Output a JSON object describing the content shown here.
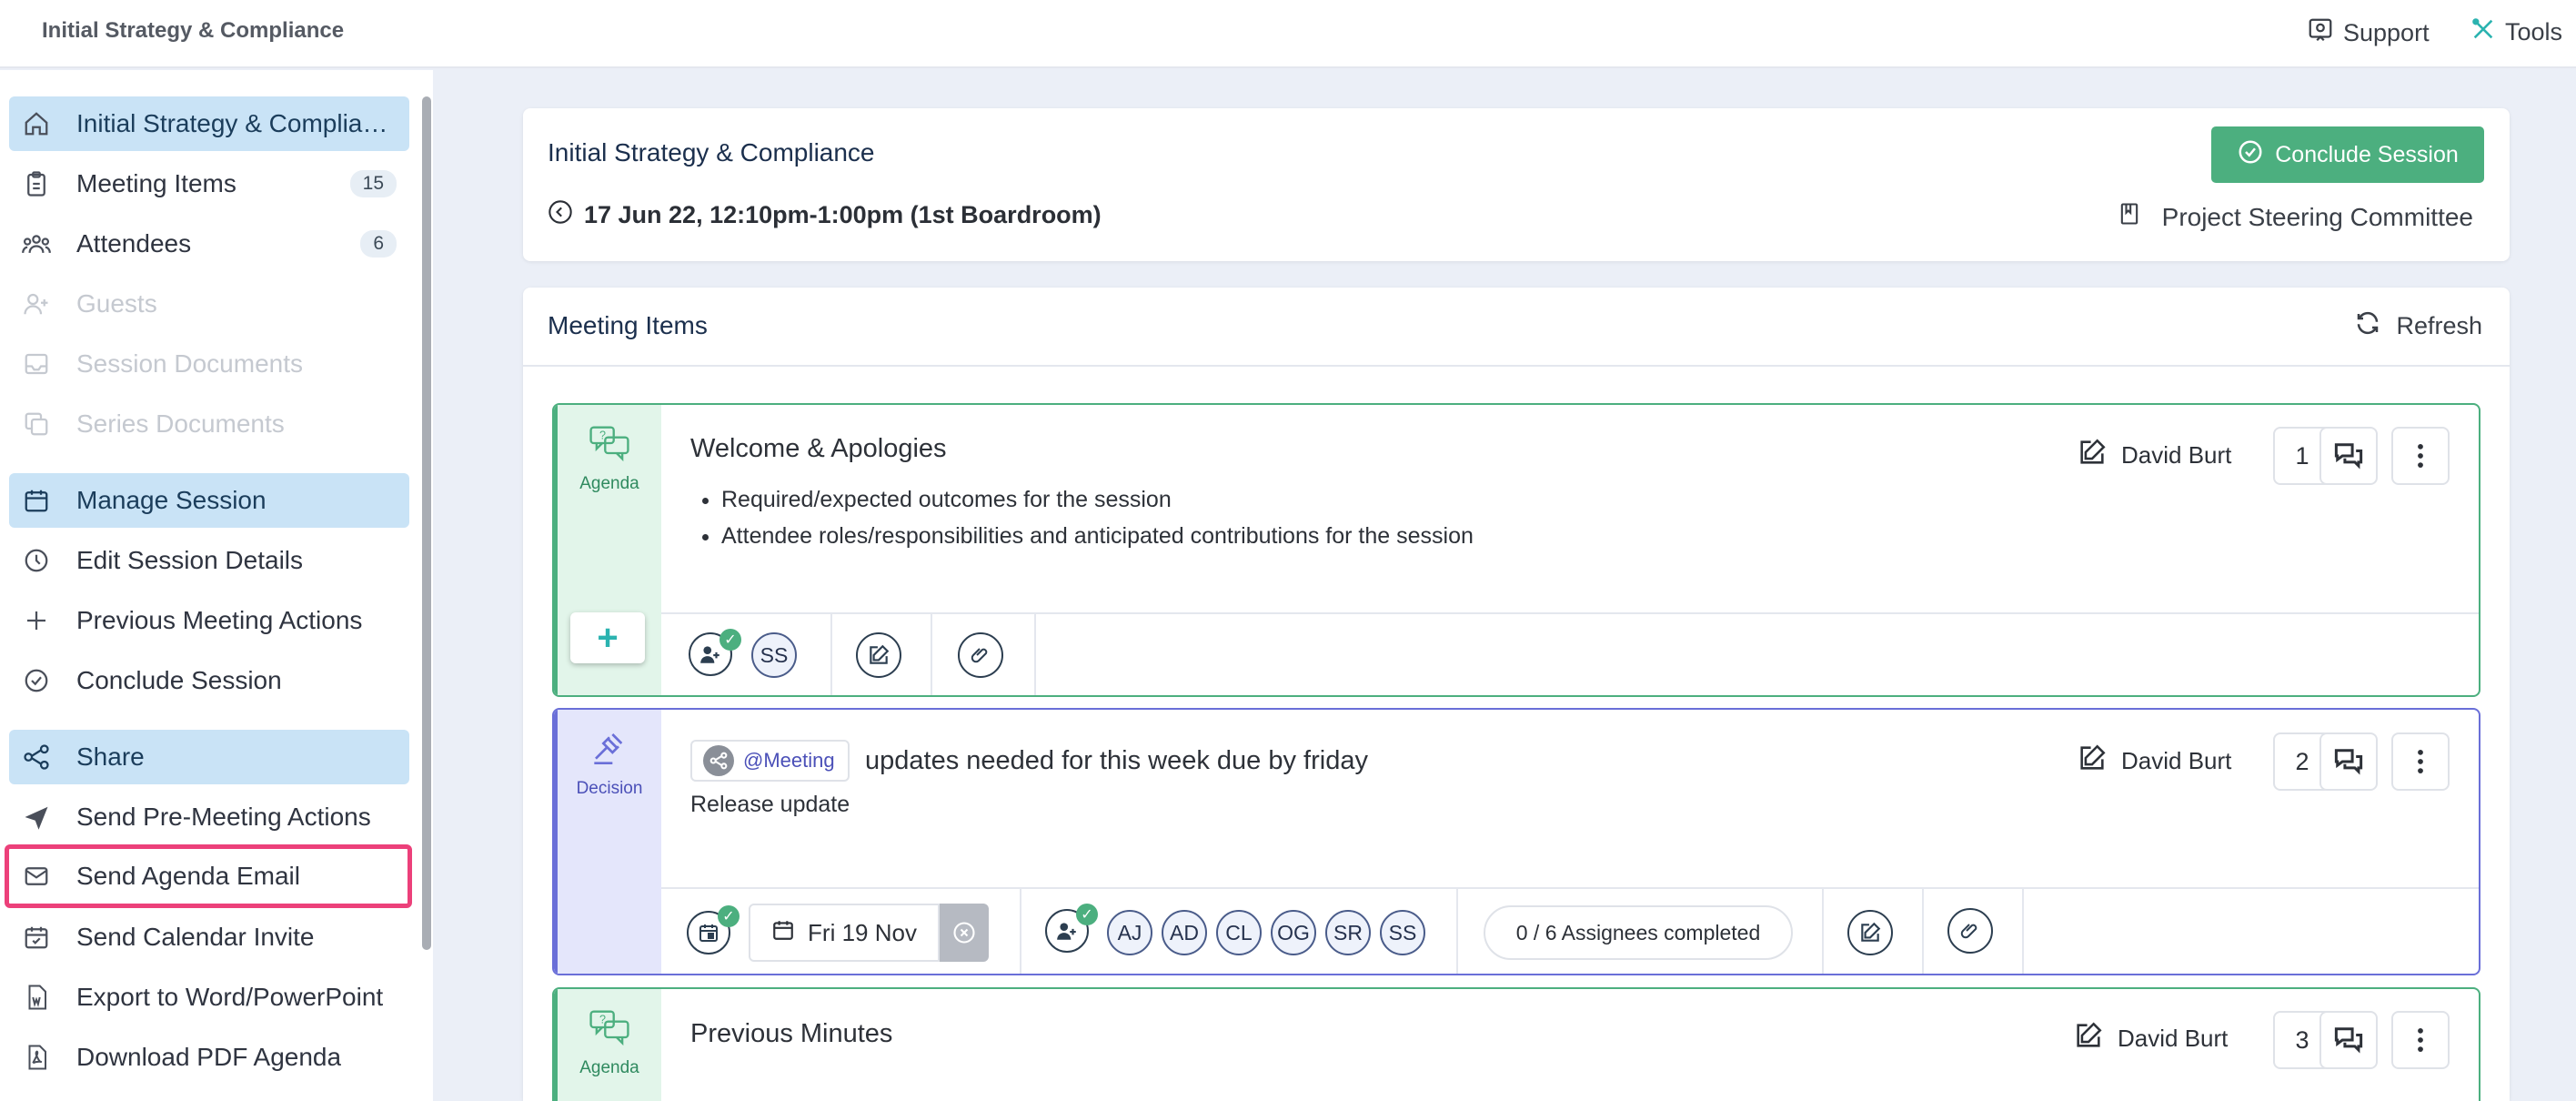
{
  "app": {
    "title": "Initial Strategy & Compliance"
  },
  "topbar": {
    "support": "Support",
    "tools": "Tools"
  },
  "sidebar": {
    "items": [
      {
        "label": "Initial Strategy & Compliance",
        "icon": "home-icon"
      },
      {
        "label": "Meeting Items",
        "icon": "clipboard-icon",
        "count": "15"
      },
      {
        "label": "Attendees",
        "icon": "users-icon",
        "count": "6"
      },
      {
        "label": "Guests",
        "icon": "user-plus-icon"
      },
      {
        "label": "Session Documents",
        "icon": "inbox-icon"
      },
      {
        "label": "Series Documents",
        "icon": "copy-icon"
      },
      {
        "label": "Manage Session",
        "icon": "calendar-icon"
      },
      {
        "label": "Edit Session Details",
        "icon": "clock-icon"
      },
      {
        "label": "Previous Meeting Actions",
        "icon": "plus-icon"
      },
      {
        "label": "Conclude Session",
        "icon": "check-circle-icon"
      },
      {
        "label": "Share",
        "icon": "share-icon"
      },
      {
        "label": "Send Pre-Meeting Actions",
        "icon": "send-icon"
      },
      {
        "label": "Send Agenda Email",
        "icon": "mail-icon"
      },
      {
        "label": "Send Calendar Invite",
        "icon": "calendar-check-icon"
      },
      {
        "label": "Export to Word/PowerPoint",
        "icon": "word-file-icon"
      },
      {
        "label": "Download PDF Agenda",
        "icon": "pdf-file-icon"
      }
    ]
  },
  "session": {
    "title": "Initial Strategy & Compliance",
    "datetime": "17 Jun 22, 12:10pm-1:00pm (1st Boardroom)",
    "committee": "Project Steering Committee",
    "conclude_button": "Conclude Session"
  },
  "meeting_items": {
    "heading": "Meeting Items",
    "refresh": "Refresh",
    "items": [
      {
        "type": "Agenda",
        "title": "Welcome & Apologies",
        "bullets": [
          "Required/expected outcomes for the session",
          "Attendee roles/responsibilities and anticipated contributions for the session"
        ],
        "owner": "David Burt",
        "number": "1",
        "attendees": [
          "SS"
        ]
      },
      {
        "type": "Decision",
        "tag": "@Meeting",
        "title": "updates needed for this week due by friday",
        "description": "Release update",
        "owner": "David Burt",
        "number": "2",
        "due_date": "Fri 19 Nov",
        "attendees": [
          "AJ",
          "AD",
          "CL",
          "OG",
          "SR",
          "SS"
        ],
        "assignees_status": "0 / 6 Assignees completed"
      },
      {
        "type": "Agenda",
        "title": "Previous Minutes",
        "owner": "David Burt",
        "number": "3"
      }
    ]
  },
  "colors": {
    "agenda": "#4caf7f",
    "decision": "#6a6fd8",
    "highlight": "#ec407a",
    "active_bg": "#c9e3f6"
  }
}
